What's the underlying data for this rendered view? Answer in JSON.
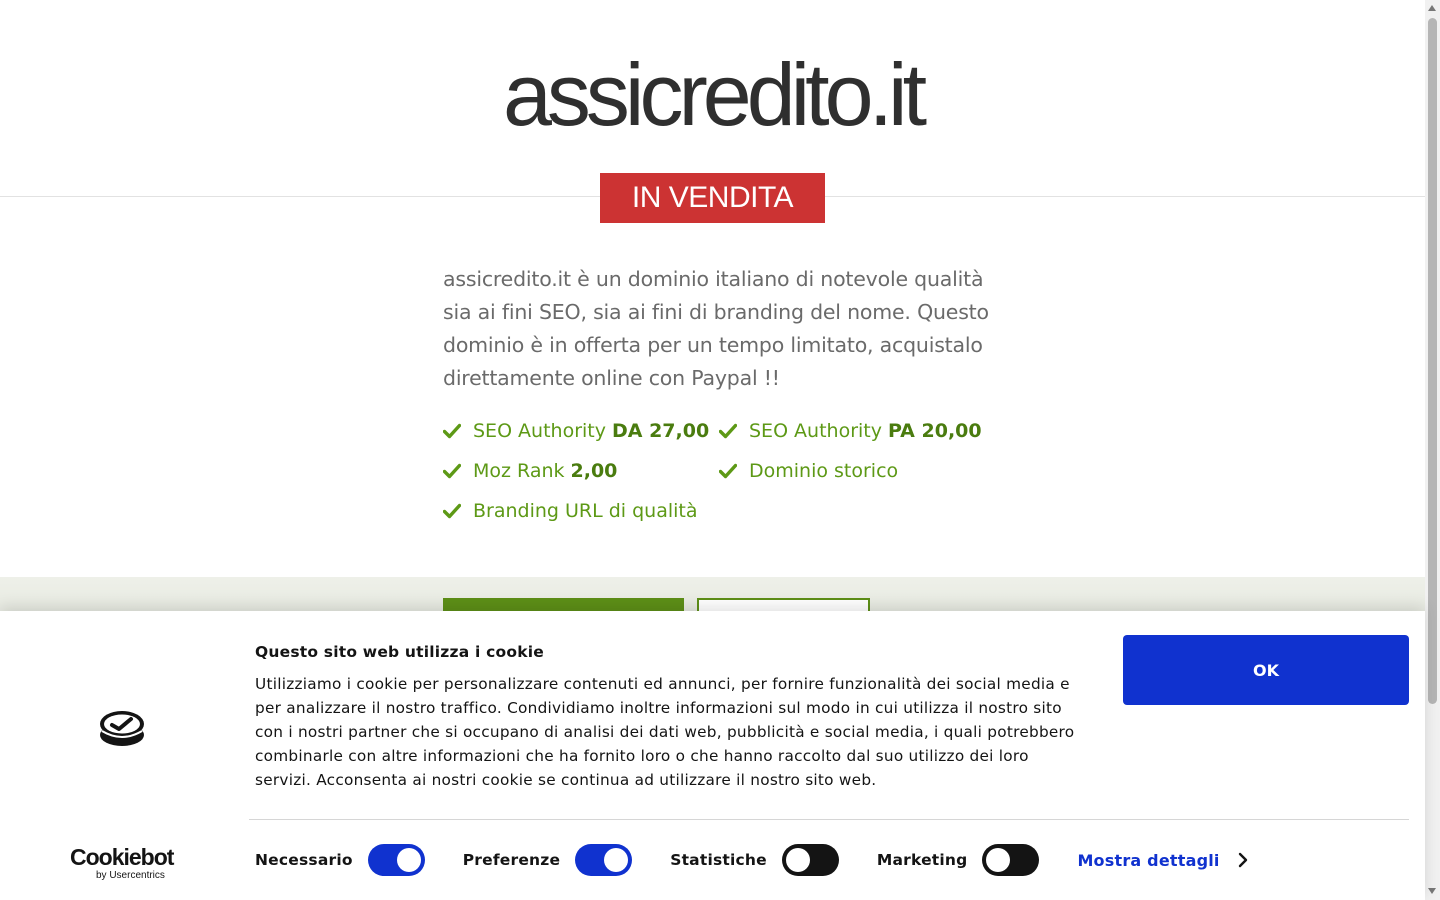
{
  "hero": {
    "domain_title": "assicredito.it",
    "badge": "IN VENDITA",
    "description": "assicredito.it è un dominio italiano di notevole qualità sia ai fini SEO, sia ai fini di branding del nome. Questo dominio è in offerta per un tempo limitato, acquistalo direttamente online con Paypal !!"
  },
  "features": [
    {
      "label": "SEO Authority",
      "value": "DA 27,00"
    },
    {
      "label": "SEO Authority",
      "value": "PA 20,00"
    },
    {
      "label": "Moz Rank",
      "value": "2,00"
    },
    {
      "label": "Dominio storico",
      "value": ""
    },
    {
      "label": "Branding URL di qualità",
      "value": ""
    }
  ],
  "cookie_banner": {
    "heading": "Questo sito web utilizza i cookie",
    "text": "Utilizziamo i cookie per personalizzare contenuti ed annunci, per fornire funzionalità dei social media e per analizzare il nostro traffico. Condividiamo inoltre informazioni sul modo in cui utilizza il nostro sito con i nostri partner che si occupano di analisi dei dati web, pubblicità e social media, i quali potrebbero combinarle con altre informazioni che ha fornito loro o che hanno raccolto dal suo utilizzo dei loro servizi. Acconsenta ai nostri cookie se continua ad utilizzare il nostro sito web.",
    "ok_label": "OK",
    "brand_main": "Cookiebot",
    "brand_sub": "by Usercentrics",
    "consents": [
      {
        "label": "Necessario",
        "on": true
      },
      {
        "label": "Preferenze",
        "on": true
      },
      {
        "label": "Statistiche",
        "on": false
      },
      {
        "label": "Marketing",
        "on": false
      }
    ],
    "details_label": "Mostra dettagli"
  },
  "colors": {
    "badge_red": "#cc3333",
    "feature_green": "#5d9916",
    "cookie_blue": "#1032cf"
  }
}
